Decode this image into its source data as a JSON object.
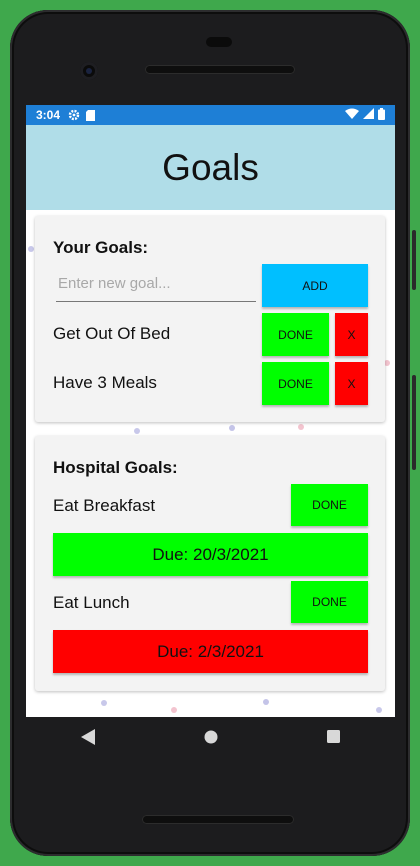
{
  "status_bar": {
    "time": "3:04",
    "icons": [
      "gear-icon",
      "sd-card-icon"
    ],
    "right_icons": [
      "wifi-icon",
      "signal-icon",
      "battery-icon"
    ]
  },
  "app_bar": {
    "title": "Goals"
  },
  "your_goals": {
    "title": "Your Goals:",
    "input_placeholder": "Enter new goal...",
    "add_label": "ADD",
    "items": [
      {
        "label": "Get Out Of Bed",
        "done_label": "DONE",
        "remove_label": "X"
      },
      {
        "label": "Have 3 Meals",
        "done_label": "DONE",
        "remove_label": "X"
      }
    ]
  },
  "hospital_goals": {
    "title": "Hospital Goals:",
    "items": [
      {
        "label": "Eat Breakfast",
        "done_label": "DONE",
        "due": "Due: 20/3/2021",
        "due_color": "#00ff00"
      },
      {
        "label": "Eat Lunch",
        "done_label": "DONE",
        "due": "Due: 2/3/2021",
        "due_color": "#ff0000"
      }
    ]
  },
  "nav_bar": {
    "icons": [
      "back-icon",
      "home-icon",
      "recents-icon"
    ]
  },
  "colors": {
    "status_bar": "#1e7fd6",
    "app_bar": "#b0dde8",
    "add_button": "#00bfff",
    "done_button": "#00ff00",
    "remove_button": "#ff0000",
    "background": "#3fa84c"
  }
}
